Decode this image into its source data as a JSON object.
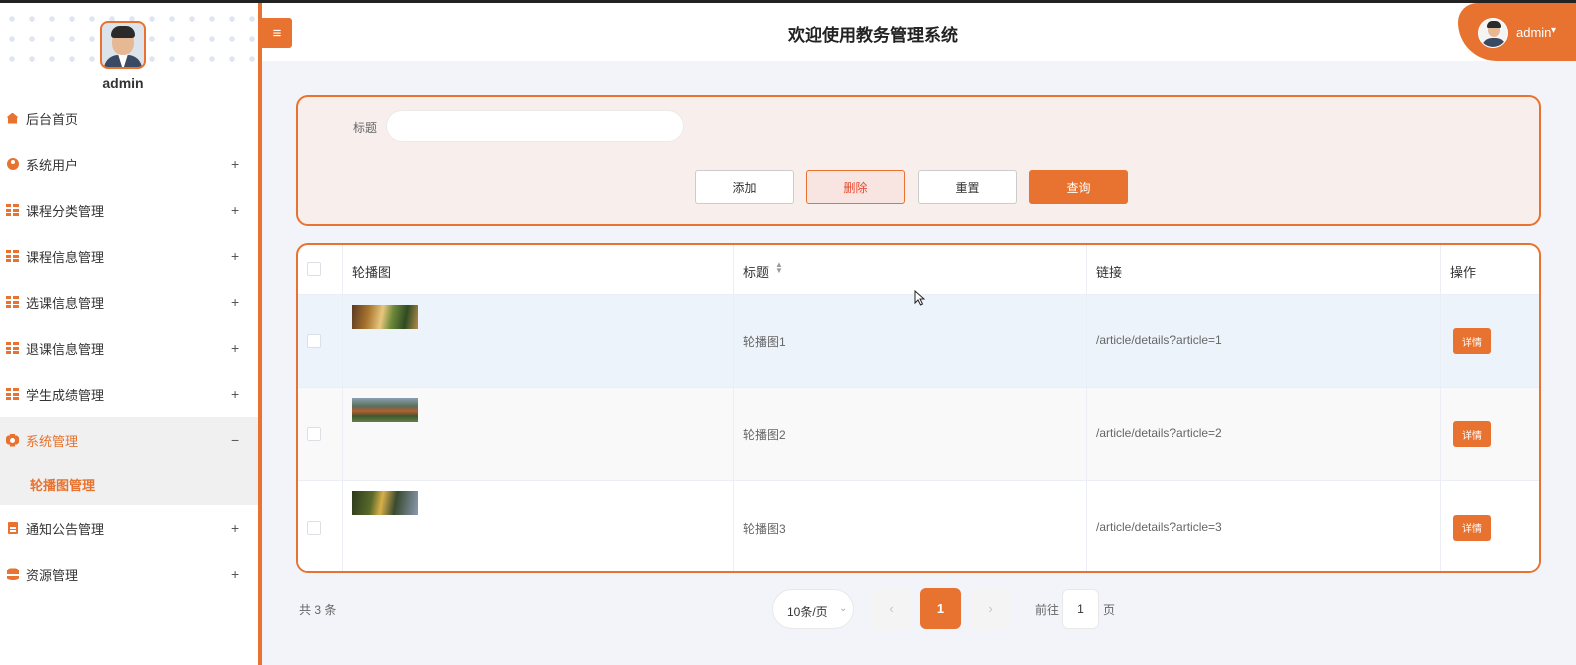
{
  "header": {
    "title": "欢迎使用教务管理系统",
    "menu_toggle_icon": "hamburger-icon",
    "username": "admin",
    "caret": "▾"
  },
  "sidebar": {
    "username": "admin",
    "items": [
      {
        "label": "后台首页",
        "icon": "home-icon",
        "toggle": ""
      },
      {
        "label": "系统用户",
        "icon": "user-icon",
        "toggle": "+"
      },
      {
        "label": "课程分类管理",
        "icon": "grid-icon",
        "toggle": "+"
      },
      {
        "label": "课程信息管理",
        "icon": "grid-icon",
        "toggle": "+"
      },
      {
        "label": "选课信息管理",
        "icon": "grid-icon",
        "toggle": "+"
      },
      {
        "label": "退课信息管理",
        "icon": "grid-icon",
        "toggle": "+"
      },
      {
        "label": "学生成绩管理",
        "icon": "grid-icon",
        "toggle": "+"
      },
      {
        "label": "系统管理",
        "icon": "gear-icon",
        "toggle": "−",
        "active": true
      },
      {
        "label": "通知公告管理",
        "icon": "doc-icon",
        "toggle": "+"
      },
      {
        "label": "资源管理",
        "icon": "database-icon",
        "toggle": "+"
      }
    ],
    "submenu": {
      "label": "轮播图管理"
    }
  },
  "search": {
    "title_label": "标题",
    "title_value": "",
    "title_placeholder": "",
    "add_label": "添加",
    "delete_label": "删除",
    "reset_label": "重置",
    "query_label": "查询"
  },
  "table": {
    "columns": [
      "轮播图",
      "标题",
      "链接",
      "操作"
    ],
    "sort_icon": "▲▼",
    "rows": [
      {
        "image": "carousel-image-1",
        "title": "轮播图1",
        "link": "/article/details?article=1",
        "action": "详情"
      },
      {
        "image": "carousel-image-2",
        "title": "轮播图2",
        "link": "/article/details?article=2",
        "action": "详情"
      },
      {
        "image": "carousel-image-3",
        "title": "轮播图3",
        "link": "/article/details?article=3",
        "action": "详情"
      }
    ]
  },
  "pagination": {
    "total_text": "共 3 条",
    "page_size": "10条/页",
    "prev": "‹",
    "current": "1",
    "next": "›",
    "goto_label": "前往",
    "goto_value": "1",
    "goto_suffix": "页"
  },
  "colors": {
    "accent": "#e8722f",
    "danger_text": "#e84a2f",
    "panel_bg": "#f8eeec",
    "page_bg": "#f2f4f9"
  }
}
